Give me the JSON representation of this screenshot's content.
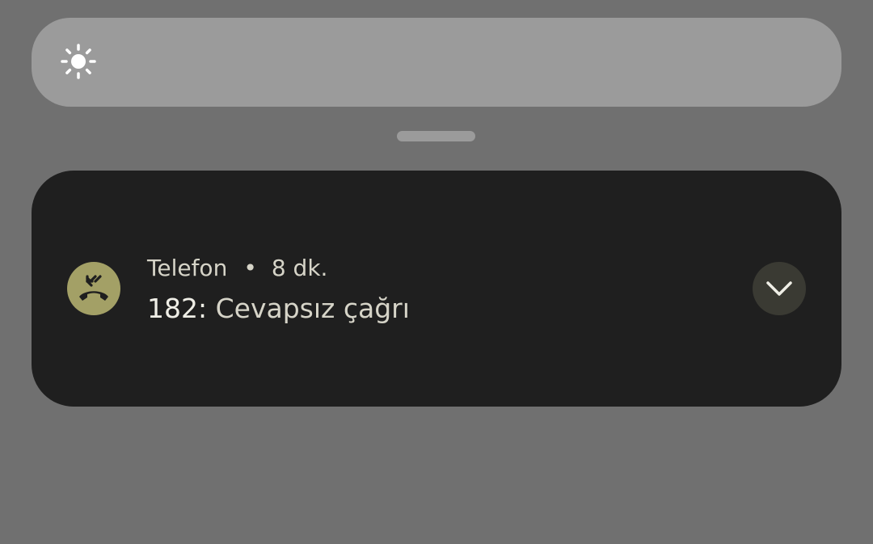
{
  "quick_settings": {
    "brightness_icon": "brightness-sun-icon"
  },
  "notification": {
    "app_icon": "missed-call-icon",
    "app_name": "Telefon",
    "separator": "•",
    "time": "8 dk.",
    "caller": "182:",
    "message": "Cevapsız çağrı",
    "expand_icon": "chevron-down-icon"
  },
  "colors": {
    "background": "#707070",
    "brightness_bar": "#9b9b9b",
    "card": "#1f1f1f",
    "icon_accent": "#a3a066",
    "expand_button": "#3a3a33",
    "text_primary": "#efeee6",
    "text_secondary": "#d6d4c8"
  }
}
